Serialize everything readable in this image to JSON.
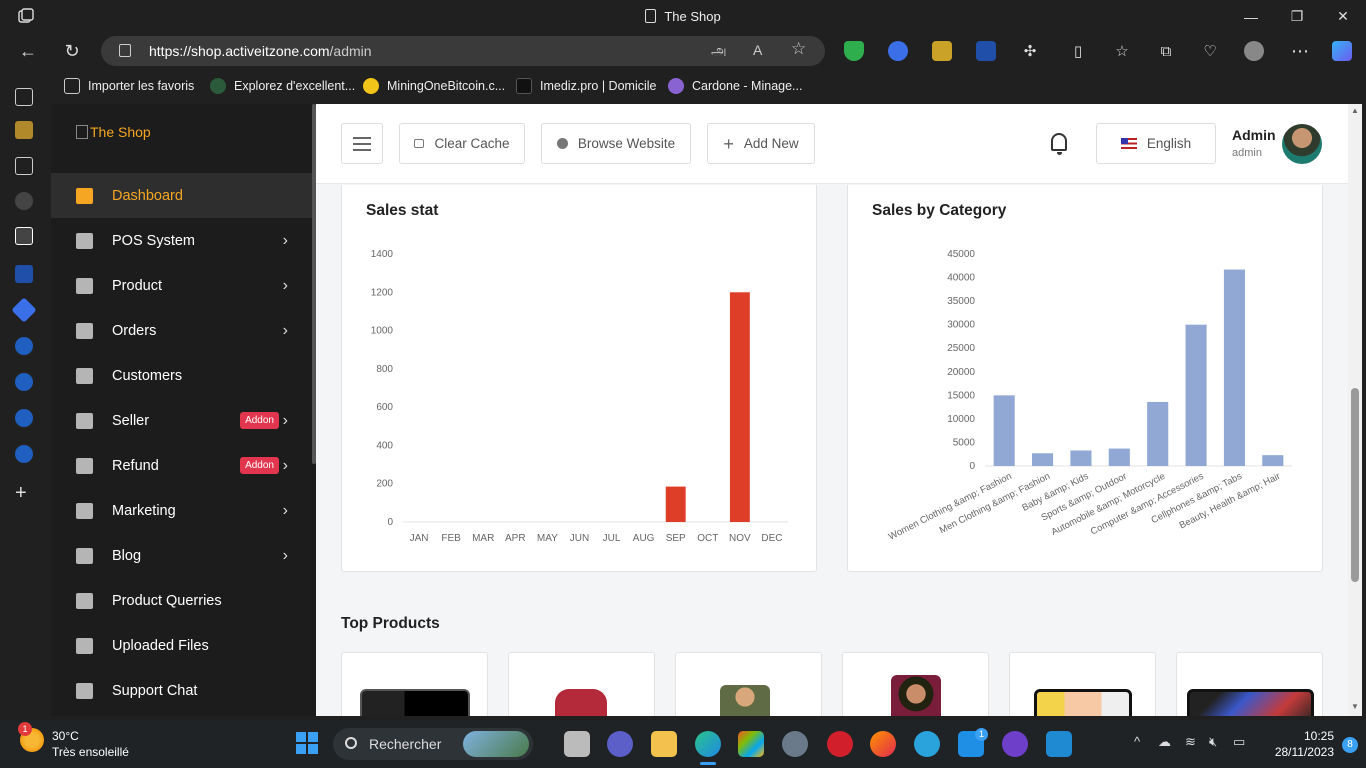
{
  "browser": {
    "tab_title": "The Shop",
    "url_host": "https://shop.activeitzone.com",
    "url_path": "/admin",
    "favorites": [
      "Importer les favoris",
      "Explorez d'excellent...",
      "MiningOneBitcoin.c...",
      "Imediz.pro | Domicile",
      "Cardone - Minage..."
    ]
  },
  "app": {
    "logo_alt": "The Shop",
    "menu": [
      {
        "label": "Dashboard",
        "icon": "dashboard-icon",
        "chevron": false,
        "addon": false,
        "active": true
      },
      {
        "label": "POS System",
        "icon": "pos-icon",
        "chevron": true,
        "addon": false
      },
      {
        "label": "Product",
        "icon": "product-icon",
        "chevron": true,
        "addon": false
      },
      {
        "label": "Orders",
        "icon": "orders-icon",
        "chevron": true,
        "addon": false
      },
      {
        "label": "Customers",
        "icon": "customers-icon",
        "chevron": false,
        "addon": false
      },
      {
        "label": "Seller",
        "icon": "seller-icon",
        "chevron": true,
        "addon": true
      },
      {
        "label": "Refund",
        "icon": "refund-icon",
        "chevron": true,
        "addon": true
      },
      {
        "label": "Marketing",
        "icon": "marketing-icon",
        "chevron": true,
        "addon": false
      },
      {
        "label": "Blog",
        "icon": "blog-icon",
        "chevron": true,
        "addon": false
      },
      {
        "label": "Product Querries",
        "icon": "querries-icon",
        "chevron": false,
        "addon": false
      },
      {
        "label": "Uploaded Files",
        "icon": "files-icon",
        "chevron": false,
        "addon": false
      },
      {
        "label": "Support Chat",
        "icon": "chat-icon",
        "chevron": false,
        "addon": false
      }
    ],
    "addon_label": "Addon",
    "topbar": {
      "clear_cache": "Clear Cache",
      "browse_website": "Browse Website",
      "add_new": "Add New",
      "language": "English",
      "user_name": "Admin",
      "user_role": "admin"
    },
    "sales_stat_title": "Sales stat",
    "sales_by_category_title": "Sales by Category",
    "top_products_title": "Top Products"
  },
  "chart_data": [
    {
      "type": "bar",
      "title": "Sales stat",
      "categories": [
        "JAN",
        "FEB",
        "MAR",
        "APR",
        "MAY",
        "JUN",
        "JUL",
        "AUG",
        "SEP",
        "OCT",
        "NOV",
        "DEC"
      ],
      "values": [
        0,
        0,
        0,
        0,
        0,
        0,
        0,
        0,
        185,
        0,
        1200,
        0
      ],
      "yticks": [
        0,
        200,
        400,
        600,
        800,
        1000,
        1200,
        1400
      ],
      "ylim": [
        0,
        1400
      ],
      "color": "#de3e27"
    },
    {
      "type": "bar",
      "title": "Sales by Category",
      "categories": [
        "Women Clothing &amp; Fashion",
        "Men Clothing &amp; Fashion",
        "Baby &amp; Kids",
        "Sports &amp; Outdoor",
        "Automobile &amp; Motorcycle",
        "Computer &amp; Accessories",
        "Cellphones &amp; Tabs",
        "Beauty, Health &amp; Hair"
      ],
      "values": [
        15000,
        2700,
        3300,
        3700,
        13600,
        30000,
        41700,
        2300
      ],
      "yticks": [
        0,
        5000,
        10000,
        15000,
        20000,
        25000,
        30000,
        35000,
        40000,
        45000
      ],
      "ylim": [
        0,
        45000
      ],
      "color": "#91a8d5"
    }
  ],
  "taskbar": {
    "temperature": "30°C",
    "weather": "Très ensoleillé",
    "weather_badge": "1",
    "search": "Rechercher",
    "time": "10:25",
    "date": "28/11/2023",
    "notifications": "8",
    "mail_badge": "1"
  }
}
